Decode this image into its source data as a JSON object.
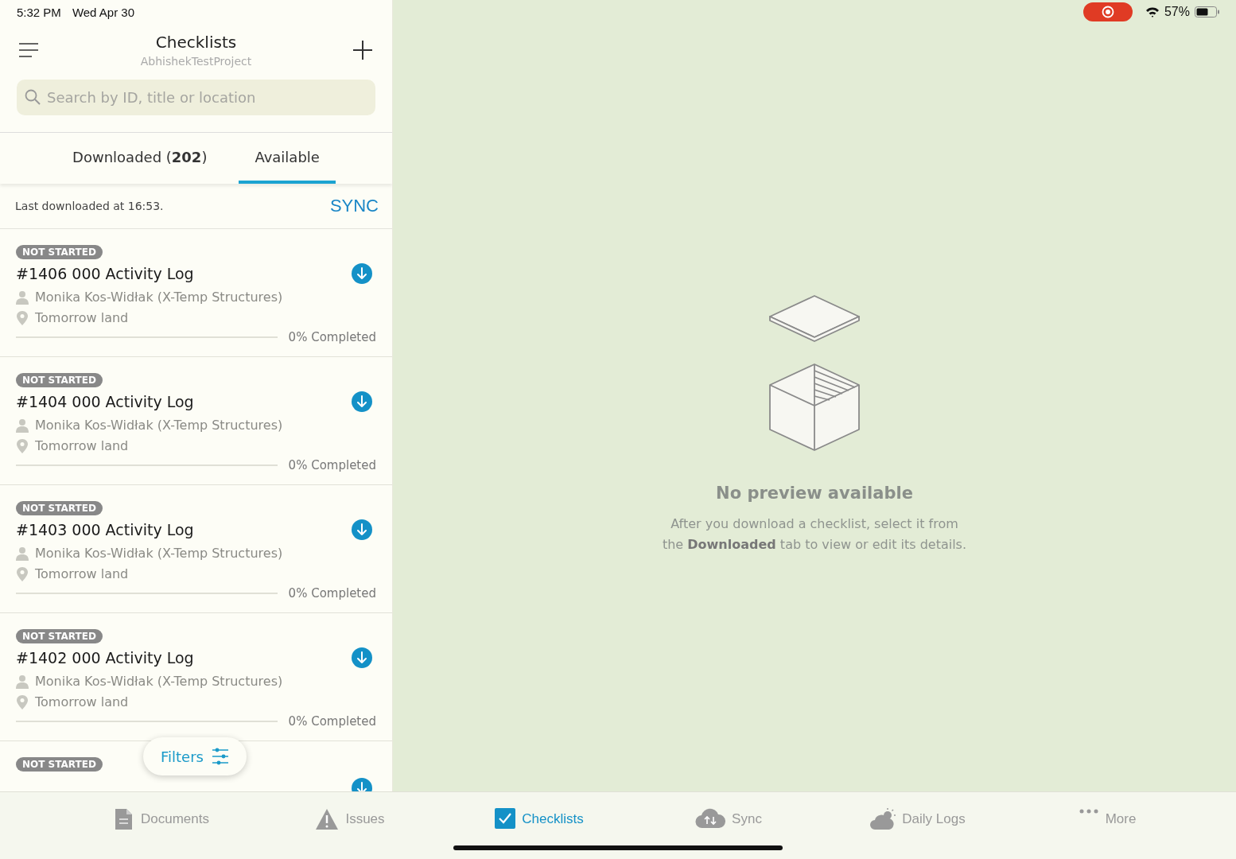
{
  "status_bar": {
    "time": "5:32 PM",
    "date": "Wed Apr 30",
    "recording": true,
    "battery": "57%"
  },
  "header": {
    "title": "Checklists",
    "subtitle": "AbhishekTestProject"
  },
  "search": {
    "placeholder": "Search by ID, title or location"
  },
  "tabs": [
    {
      "label": "Downloaded (**202**)",
      "selected": false
    },
    {
      "label": "Available",
      "selected": true
    }
  ],
  "sync_row": {
    "text": "Last downloaded at 16:53.",
    "action": "SYNC"
  },
  "checklists": [
    {
      "status": "NOT STARTED",
      "title": "#1406 000 Activity Log",
      "assignee": "Monika Kos-Widłak (X-Temp Structures)",
      "location": "Tomorrow land",
      "progress": "0% Completed",
      "level": 0
    },
    {
      "status": "NOT STARTED",
      "title": "#1404 000 Activity Log",
      "assignee": "Monika Kos-Widłak (X-Temp Structures)",
      "location": "Tomorrow land",
      "progress": "0% Completed",
      "level": 0
    },
    {
      "status": "NOT STARTED",
      "title": "#1403 000 Activity Log",
      "assignee": "Monika Kos-Widłak (X-Temp Structures)",
      "location": "Tomorrow land",
      "progress": "0% Completed",
      "level": 0
    },
    {
      "status": "NOT STARTED",
      "title": "#1402 000 Activity Log",
      "assignee": "Monika Kos-Widłak (X-Temp Structures)",
      "location": "Tomorrow land",
      "progress": "0% Completed",
      "level": 0
    },
    {
      "status": "NOT STARTED"
    }
  ],
  "filters_button": {
    "label": "Filters"
  },
  "empty_state": {
    "title": "No preview available",
    "message": "After you download a checklist, select it from the **Downloaded** tab to view or edit its details."
  },
  "tab_bar": [
    {
      "kind": "documents",
      "label": "Documents",
      "selected": false
    },
    {
      "kind": "issues",
      "label": "Issues",
      "selected": false
    },
    {
      "kind": "checklists",
      "label": "Checklists",
      "selected": true
    },
    {
      "kind": "sync",
      "label": "Sync",
      "selected": false
    },
    {
      "kind": "daily_logs",
      "label": "Daily Logs",
      "selected": false
    },
    {
      "kind": "more",
      "label": "More",
      "selected": false
    }
  ]
}
